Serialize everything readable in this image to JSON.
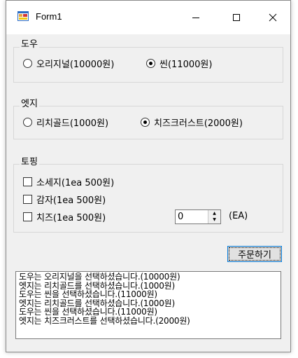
{
  "window": {
    "title": "Form1",
    "icon": "winforms-app-icon",
    "controls": {
      "minimize": "minimize-icon",
      "maximize": "maximize-icon",
      "close": "close-icon"
    }
  },
  "dough": {
    "label": "도우",
    "options": [
      {
        "label": "오리지널(10000원)",
        "selected": false
      },
      {
        "label": "씬(11000원)",
        "selected": true
      }
    ]
  },
  "edge": {
    "label": "엣지",
    "options": [
      {
        "label": "리치골드(1000원)",
        "selected": false
      },
      {
        "label": "치즈크러스트(2000원)",
        "selected": true
      }
    ]
  },
  "topping": {
    "label": "토핑",
    "items": [
      {
        "label": "소세지(1ea 500원)",
        "checked": false
      },
      {
        "label": "감자(1ea 500원)",
        "checked": false
      },
      {
        "label": "치즈(1ea 500원)",
        "checked": false
      }
    ],
    "quantity": "0",
    "unit_label": "(EA)"
  },
  "order_button": "주문하기",
  "log": [
    "도우는 오리지널을 선택하셨습니다.(10000원)",
    "엣지는 리치골드를 선택하셨습니다.(1000원)",
    "도우는 씬을 선택하셨습니다.(11000원)",
    "엣지는 리치골드를 선택하셨습니다.(1000원)",
    "도우는 씬을 선택하셨습니다.(11000원)",
    "엣지는 치즈크러스트를 선택하셨습니다.(2000원)"
  ]
}
